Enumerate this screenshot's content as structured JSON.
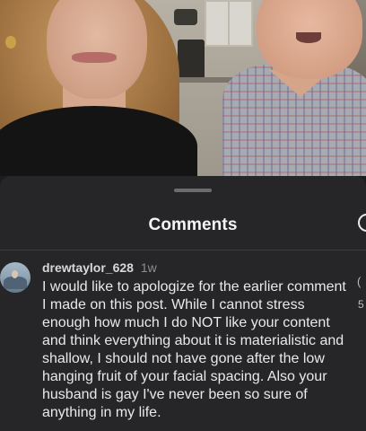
{
  "sheet": {
    "title": "Comments"
  },
  "comment": {
    "username": "drewtaylor_628",
    "timestamp": "1w",
    "text": "I would like to apologize for the earlier comment I made on this post. While I cannot stress enough how much I do NOT like your content and think everything about it is materialistic and shallow, I should not have gone after the low hanging fruit of your facial spacing. Also your husband is gay I've never been so sure of anything in my life.",
    "like_glyph": "(",
    "like_count": "5"
  },
  "colors": {
    "sheet_background": "#262628",
    "text_primary": "#e9e9ea",
    "text_secondary": "#8e8e93"
  },
  "icons": {
    "avatar": "avatar",
    "like": "heart-icon",
    "header_action": "circle-icon"
  }
}
